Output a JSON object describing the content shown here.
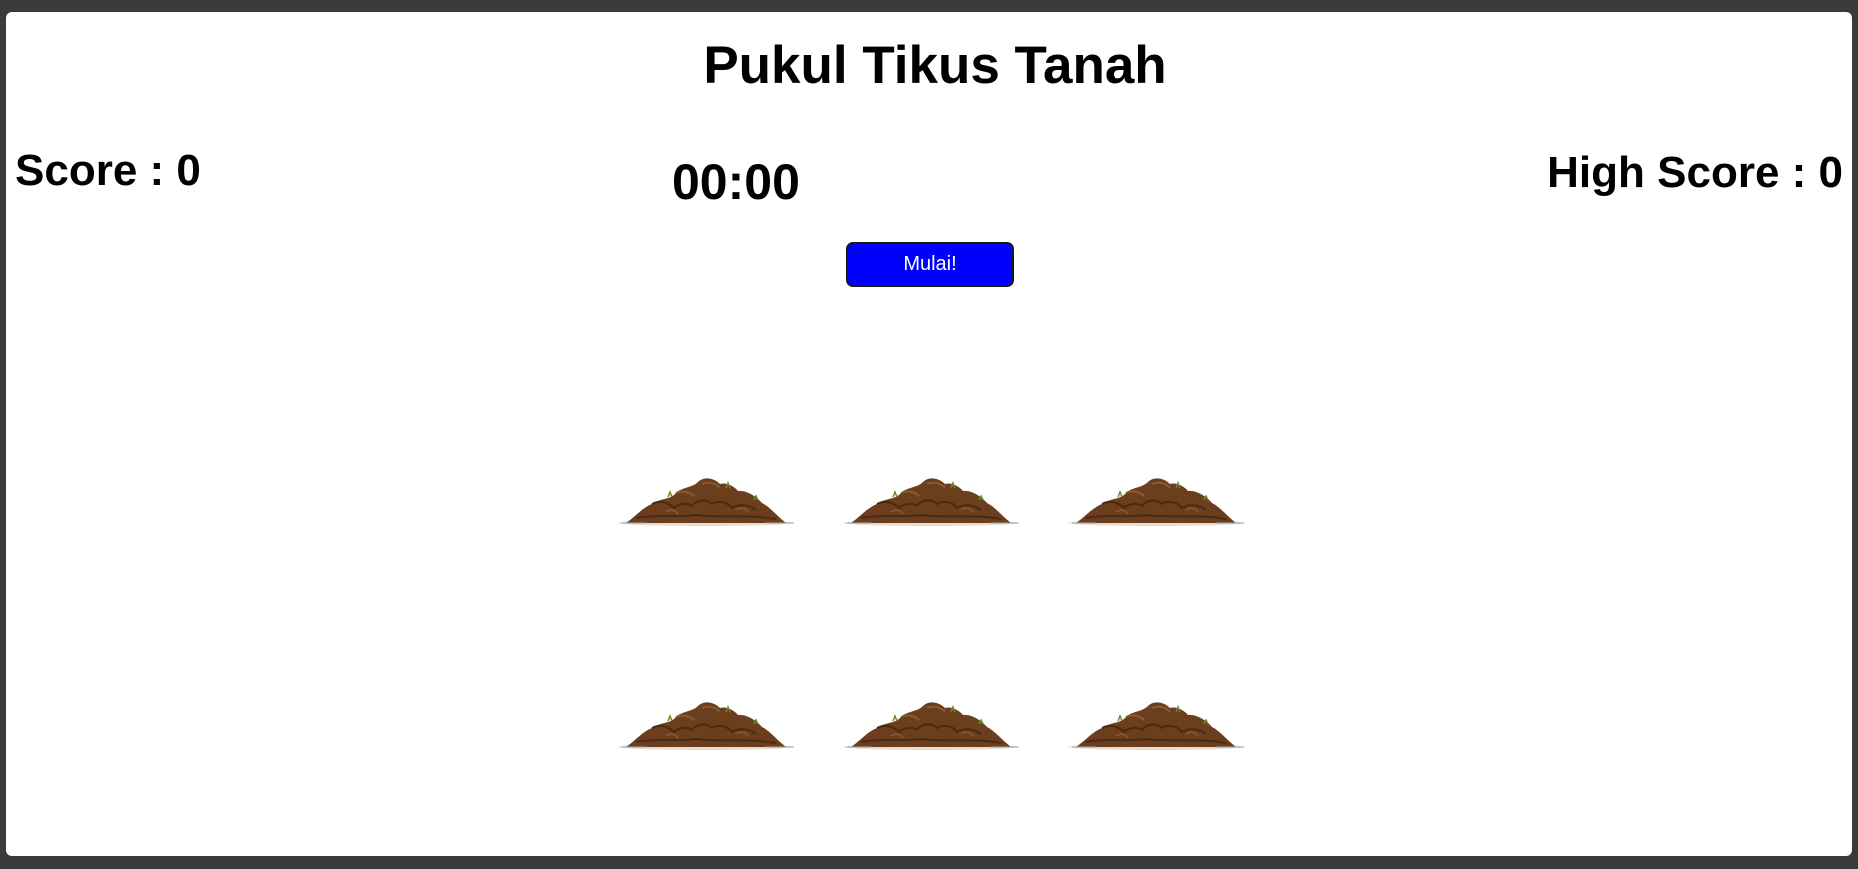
{
  "game": {
    "title": "Pukul Tikus Tanah",
    "score_label": "Score : ",
    "score_value": "0",
    "high_score_label": "High Score : ",
    "high_score_value": "0",
    "timer": "00:00",
    "start_button_label": "Mulai!"
  },
  "holes": [
    {
      "name": "dirt-mound-1"
    },
    {
      "name": "dirt-mound-2"
    },
    {
      "name": "dirt-mound-3"
    },
    {
      "name": "dirt-mound-4"
    },
    {
      "name": "dirt-mound-5"
    },
    {
      "name": "dirt-mound-6"
    }
  ],
  "colors": {
    "background": "#ffffff",
    "button": "#0000ff",
    "button_text": "#ffffff",
    "dirt": "#6b3f1e",
    "frame": "#3b3b3b"
  }
}
